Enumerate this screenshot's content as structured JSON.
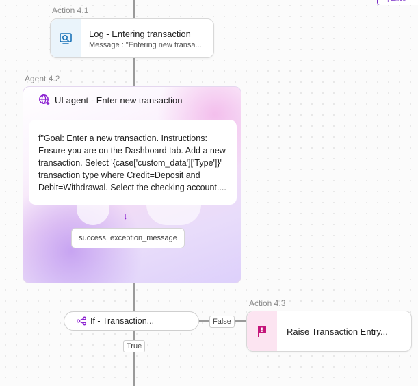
{
  "canvas": {
    "top_chip_text": "| Exce"
  },
  "log_step": {
    "step_label": "Action 4.1",
    "title": "Log - Entering transaction",
    "subtitle": "Message : \"Entering new transa...",
    "icon": "log-magnifier-icon",
    "accent": "#1a73b8"
  },
  "agent_step": {
    "step_label": "Agent 4.2",
    "title": "UI agent - Enter new transaction",
    "icon": "ui-agent-globe-icon",
    "prompt": "f\"Goal: Enter a new transaction. Instructions: Ensure you are on the Dashboard tab. Add a new transaction. Select '{case['custom_data']['Type']}' transaction type where Credit=Deposit and Debit=Withdrawal. Select the checking account....",
    "arrow": "↓",
    "outputs": "success, exception_message",
    "accent": "#8a1fd0"
  },
  "if_step": {
    "title": "If - Transaction...",
    "icon": "branch-icon",
    "true_label": "True",
    "false_label": "False"
  },
  "raise_step": {
    "step_label": "Action 4.3",
    "title": "Raise Transaction Entry...",
    "icon": "flag-icon",
    "accent": "#c4157a"
  }
}
